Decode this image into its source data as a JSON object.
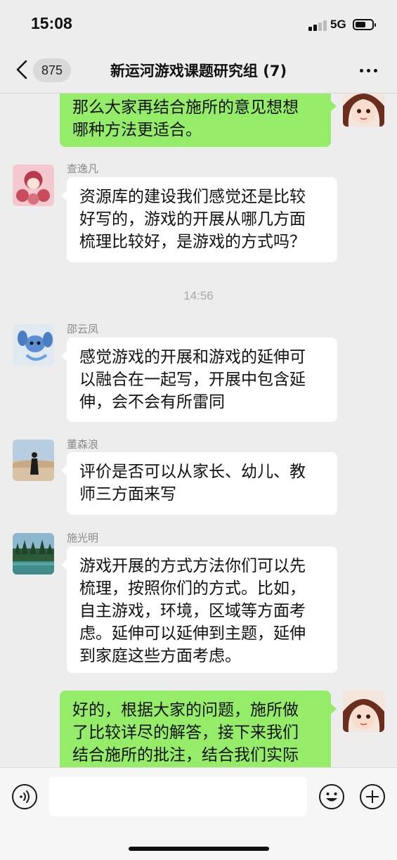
{
  "status": {
    "time": "15:08",
    "network": "5G"
  },
  "header": {
    "unread_count": "875",
    "title": "新运河游戏课题研究组 (7)"
  },
  "messages": [
    {
      "side": "out",
      "lines": [
        "那么大家再结合施所的意见想想",
        "哪种方法更适合。"
      ]
    },
    {
      "side": "in",
      "sender": "查逸凡",
      "lines": [
        "资源库的建设我们感觉还是比较",
        "好写的，游戏的开展从哪几方面",
        "梳理比较好，是游戏的方式吗？"
      ]
    },
    {
      "timestamp": "14:56"
    },
    {
      "side": "in",
      "sender": "邵云凤",
      "lines": [
        "感觉游戏的开展和游戏的延伸可",
        "以融合在一起写，开展中包含延",
        "伸，会不会有所雷同"
      ]
    },
    {
      "side": "in",
      "sender": "董森浪",
      "lines": [
        "评价是否可以从家长、幼儿、教",
        "师三方面来写"
      ]
    },
    {
      "side": "in",
      "sender": "施光明",
      "lines": [
        "游戏开展的方式方法你们可以先",
        "梳理，按照你们的方式。比如，",
        "自主游戏，环境，区域等方面考",
        "虑。延伸可以延伸到主题，延伸",
        "到家庭这些方面考虑。"
      ]
    },
    {
      "side": "out",
      "lines": [
        "好的，根据大家的问题，施所做",
        "了比较详尽的解答，接下来我们",
        "结合施所的批注，结合我们实际"
      ]
    }
  ],
  "input": {
    "placeholder": ""
  },
  "icons": {
    "voice": "voice-icon",
    "emoji": "emoji-icon",
    "add": "plus-icon",
    "back": "chevron-left-icon",
    "more": "more-icon"
  },
  "colors": {
    "outgoing_bubble": "#95ec69",
    "incoming_bubble": "#ffffff",
    "background": "#ededed"
  }
}
